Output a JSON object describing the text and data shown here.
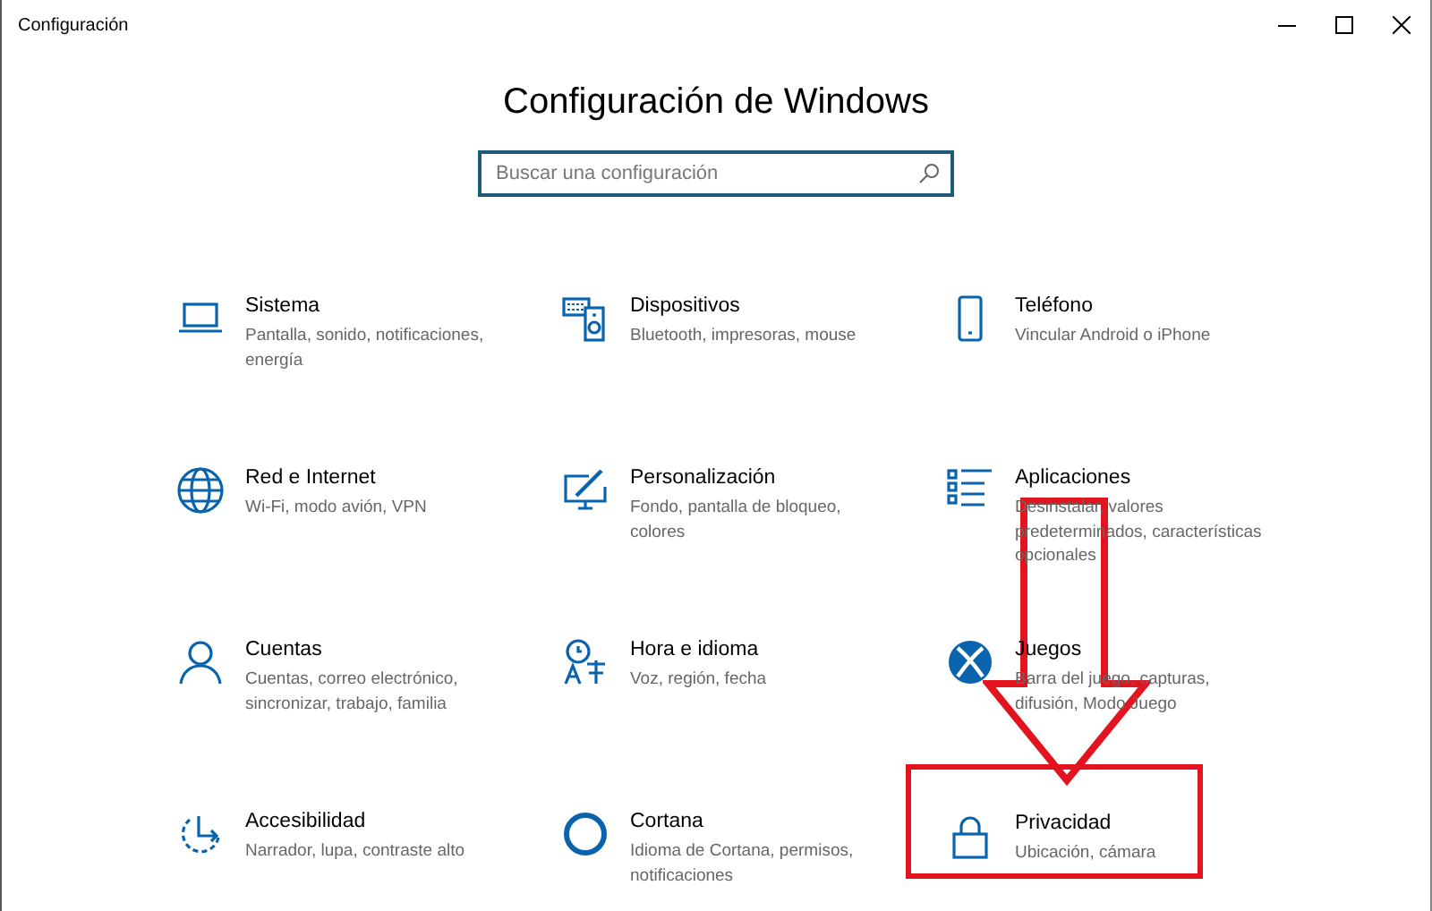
{
  "window": {
    "title": "Configuración"
  },
  "heading": "Configuración de Windows",
  "search": {
    "placeholder": "Buscar una configuración"
  },
  "tiles": [
    {
      "title": "Sistema",
      "description": "Pantalla, sonido, notificaciones, energía",
      "highlighted": false
    },
    {
      "title": "Dispositivos",
      "description": "Bluetooth, impresoras, mouse",
      "highlighted": false
    },
    {
      "title": "Teléfono",
      "description": "Vincular Android o iPhone",
      "highlighted": false
    },
    {
      "title": "Red e Internet",
      "description": "Wi-Fi, modo avión, VPN",
      "highlighted": false
    },
    {
      "title": "Personalización",
      "description": "Fondo, pantalla de bloqueo, colores",
      "highlighted": false
    },
    {
      "title": "Aplicaciones",
      "description": "Desinstalar, valores predeterminados, características opcionales",
      "highlighted": false
    },
    {
      "title": "Cuentas",
      "description": "Cuentas, correo electrónico, sincronizar, trabajo, familia",
      "highlighted": false
    },
    {
      "title": "Hora e idioma",
      "description": "Voz, región, fecha",
      "highlighted": false
    },
    {
      "title": "Juegos",
      "description": "Barra del juego, capturas, difusión, Modo Juego",
      "highlighted": false
    },
    {
      "title": "Accesibilidad",
      "description": "Narrador, lupa, contraste alto",
      "highlighted": false
    },
    {
      "title": "Cortana",
      "description": "Idioma de Cortana, permisos, notificaciones",
      "highlighted": false
    },
    {
      "title": "Privacidad",
      "description": "Ubicación, cámara",
      "highlighted": true
    }
  ]
}
